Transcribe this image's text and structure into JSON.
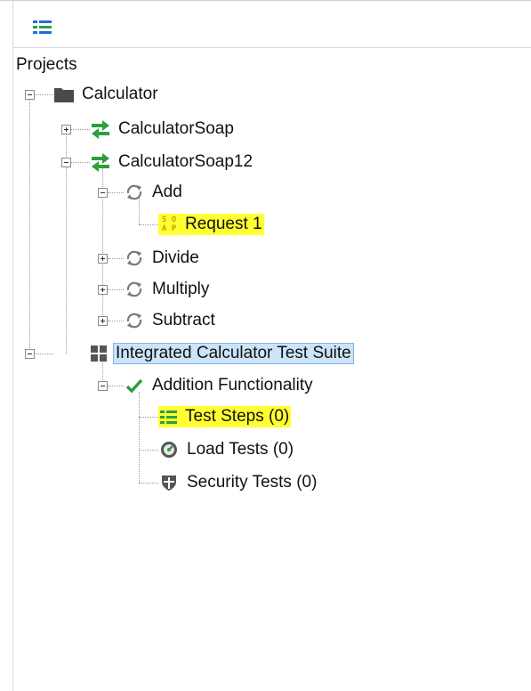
{
  "toolbar": {
    "icon": "list-icon"
  },
  "tree": {
    "root_label": "Projects",
    "project": {
      "label": "Calculator",
      "icon": "folder-icon",
      "interfaces": [
        {
          "label": "CalculatorSoap",
          "icon": "soap-interface-icon",
          "expanded": false
        },
        {
          "label": "CalculatorSoap12",
          "icon": "soap-interface-icon",
          "expanded": true,
          "operations": [
            {
              "label": "Add",
              "icon": "operation-icon",
              "expanded": true,
              "requests": [
                {
                  "label": "Request 1",
                  "icon": "soap-request-icon",
                  "highlighted": true
                }
              ]
            },
            {
              "label": "Divide",
              "icon": "operation-icon",
              "expanded": false
            },
            {
              "label": "Multiply",
              "icon": "operation-icon",
              "expanded": false
            },
            {
              "label": "Subtract",
              "icon": "operation-icon",
              "expanded": false
            }
          ]
        }
      ],
      "test_suite": {
        "label": "Integrated Calculator Test Suite",
        "icon": "test-suite-icon",
        "selected": true,
        "test_case": {
          "label": "Addition Functionality",
          "icon": "checkmark-icon",
          "children": [
            {
              "label": "Test Steps (0)",
              "icon": "test-steps-icon",
              "highlighted": true
            },
            {
              "label": "Load Tests (0)",
              "icon": "load-test-icon"
            },
            {
              "label": "Security Tests (0)",
              "icon": "security-test-icon"
            }
          ]
        }
      }
    }
  },
  "colors": {
    "highlight": "#ffff33",
    "selection": "#cce4f7",
    "interface_green": "#2e9e3e",
    "soap_gold": "#c8a000"
  }
}
